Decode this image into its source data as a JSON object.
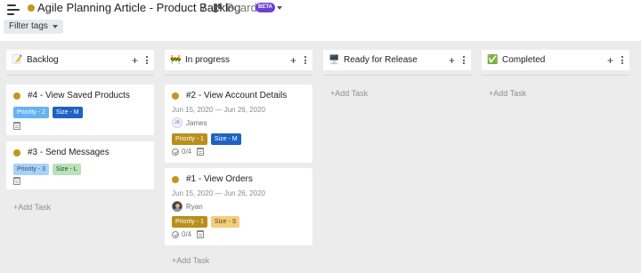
{
  "header": {
    "title": "Agile Planning Article - Product Backlog",
    "separator": "/",
    "view_label": "Board",
    "beta_badge": "BETA",
    "filter_label": "Filter tags"
  },
  "colors": {
    "accent_purple": "#6c3fd6",
    "status_dot": "#c4961d",
    "priority_1": "#b98f1c",
    "size_m": "#1f62c3"
  },
  "columns": [
    {
      "title": "Backlog",
      "emoji": "📝",
      "add_task": "+Add Task",
      "cards": [
        {
          "title": "#4 - View Saved Products",
          "tags": [
            "Priority - 2",
            "Size - M"
          ]
        },
        {
          "title": "#3 - Send Messages",
          "tags": [
            "Priority - 3",
            "Size - L"
          ]
        }
      ]
    },
    {
      "title": "In progress",
      "emoji": "🚧",
      "add_task": "+Add Task",
      "cards": [
        {
          "title": "#2 - View Account Details",
          "dates": "Jun 15, 2020 — Jun 26, 2020",
          "assignee_initials": "JA",
          "assignee": "James",
          "tags": [
            "Priority - 1",
            "Size - M"
          ],
          "subtasks": "0/4"
        },
        {
          "title": "#1 - View Orders",
          "dates": "Jun 15, 2020 — Jun 26, 2020",
          "assignee": "Ryan",
          "tags": [
            "Priority - 1",
            "Size - S"
          ],
          "subtasks": "0/4"
        }
      ]
    },
    {
      "title": "Ready for Release",
      "emoji": "🖥️",
      "add_task": "+Add Task",
      "cards": []
    },
    {
      "title": "Completed",
      "emoji": "✅",
      "add_task": "+Add Task",
      "cards": []
    }
  ]
}
